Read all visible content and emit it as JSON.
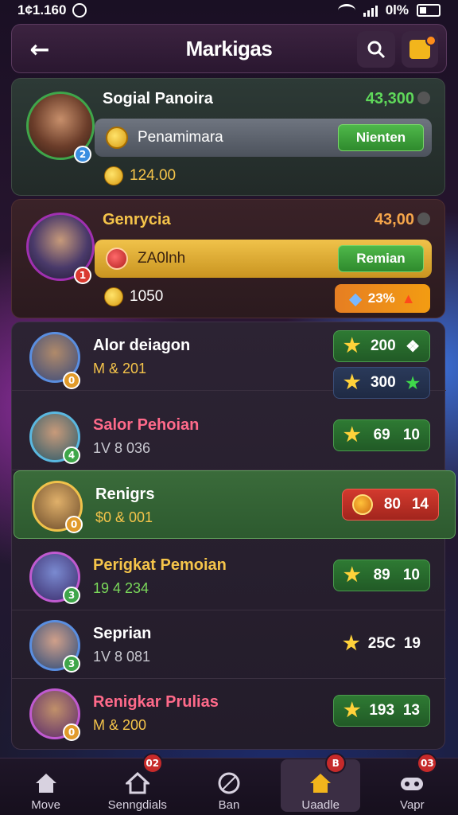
{
  "status_bar": {
    "time": "1¢1.160",
    "battery_text": "0l%"
  },
  "header": {
    "title": "Markigas"
  },
  "featured": [
    {
      "name": "Sogial Panoira",
      "score": "43,300",
      "bar_text": "Penamimara",
      "button": "Nienten",
      "coins": "124.00"
    },
    {
      "name": "Genrycia",
      "score": "43,00",
      "bar_text": "ZA0lnh",
      "button": "Remian",
      "coins": "1050",
      "percent": "23%"
    }
  ],
  "players": [
    {
      "name": "Alor deiagon",
      "sub": "M & 201",
      "value1": "200",
      "value2": "300"
    },
    {
      "name": "Salor Pehoian",
      "sub": "1V 8 036",
      "value": "69",
      "extra": "10"
    },
    {
      "name": "Renigrs",
      "sub": "$0 & 001",
      "value": "80",
      "extra": "14"
    },
    {
      "name": "Perigkat Pemoian",
      "sub": "19 4 234",
      "value": "89",
      "extra": "10"
    },
    {
      "name": "Seprian",
      "sub": "1V 8 081",
      "value": "25C",
      "extra": "19"
    },
    {
      "name": "Renigkar Prulias",
      "sub": "M & 200",
      "value": "193",
      "extra": "13"
    }
  ],
  "nav": [
    {
      "label": "Move",
      "badge": ""
    },
    {
      "label": "Senngdials",
      "badge": "02"
    },
    {
      "label": "Ban",
      "badge": ""
    },
    {
      "label": "Uaadle",
      "badge": "B"
    },
    {
      "label": "Vapr",
      "badge": "03"
    }
  ]
}
